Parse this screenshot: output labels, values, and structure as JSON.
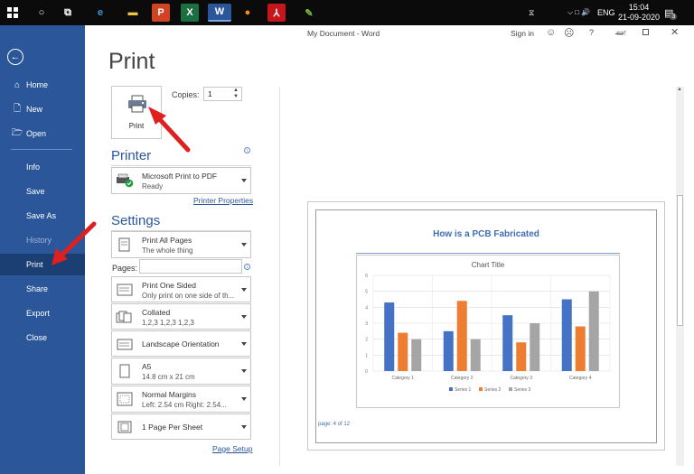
{
  "taskbar": {
    "apps": [
      {
        "name": "cortana",
        "glyph": "○",
        "color": "#ffffff",
        "bg": "#0b0b0b"
      },
      {
        "name": "task-view",
        "glyph": "⧉",
        "color": "#ffffff",
        "bg": "#0b0b0b"
      },
      {
        "name": "edge",
        "glyph": "e",
        "color": "#3a96dd",
        "bg": "#0b0b0b"
      },
      {
        "name": "file-explorer",
        "glyph": "▬",
        "color": "#f3c443",
        "bg": "#0b0b0b"
      },
      {
        "name": "powerpoint",
        "glyph": "P",
        "color": "#ffffff",
        "bg": "#d04423"
      },
      {
        "name": "excel",
        "glyph": "X",
        "color": "#ffffff",
        "bg": "#1d6f42"
      },
      {
        "name": "word",
        "glyph": "W",
        "color": "#ffffff",
        "bg": "#2b579a"
      },
      {
        "name": "firefox",
        "glyph": "●",
        "color": "#ff8a1c",
        "bg": "#0b0b0b"
      },
      {
        "name": "acrobat",
        "glyph": "⅄",
        "color": "#ffffff",
        "bg": "#c4161c"
      },
      {
        "name": "greenshot",
        "glyph": "✎",
        "color": "#7dbb3c",
        "bg": "#0b0b0b"
      }
    ],
    "lang": "ENG",
    "time": "15:04",
    "date": "21-09-2020",
    "notifications": "3"
  },
  "window": {
    "title": "My Document  -  Word",
    "signin": "Sign in",
    "help": "?"
  },
  "nav": {
    "home": "Home",
    "new": "New",
    "open": "Open",
    "info": "Info",
    "save": "Save",
    "save_as": "Save As",
    "history": "History",
    "print": "Print",
    "share": "Share",
    "export": "Export",
    "close": "Close"
  },
  "print": {
    "heading": "Print",
    "button_label": "Print",
    "copies_label": "Copies:",
    "copies_value": "1",
    "printer_heading": "Printer",
    "printer_name": "Microsoft Print to PDF",
    "printer_status": "Ready",
    "printer_properties": "Printer Properties",
    "settings_heading": "Settings",
    "pages_label": "Pages:",
    "page_setup": "Page Setup",
    "settings": [
      {
        "key": "range",
        "line1": "Print All Pages",
        "line2": "The whole thing"
      },
      {
        "key": "sides",
        "line1": "Print One Sided",
        "line2": "Only print on one side of th..."
      },
      {
        "key": "collation",
        "line1": "Collated",
        "line2": "1,2,3    1,2,3    1,2,3"
      },
      {
        "key": "orientation",
        "line1": "Landscape Orientation",
        "line2": ""
      },
      {
        "key": "paper",
        "line1": "A5",
        "line2": "14.8 cm x 21 cm"
      },
      {
        "key": "margins",
        "line1": "Normal Margins",
        "line2": "Left:  2.54 cm    Right:  2.54..."
      },
      {
        "key": "per-sheet",
        "line1": "1 Page Per Sheet",
        "line2": ""
      }
    ]
  },
  "preview": {
    "doc_heading": "How is a PCB Fabricated",
    "page_indicator": "page: 4 of 12"
  },
  "colors": {
    "accent": "#2b579a",
    "s1": "#4472c4",
    "s2": "#ed7d31",
    "s3": "#a5a5a5"
  },
  "chart_data": {
    "type": "bar",
    "title": "Chart Title",
    "categories": [
      "Category 1",
      "Category 2",
      "Category 3",
      "Category 4"
    ],
    "series": [
      {
        "name": "Series 1",
        "values": [
          4.3,
          2.5,
          3.5,
          4.5
        ]
      },
      {
        "name": "Series 2",
        "values": [
          2.4,
          4.4,
          1.8,
          2.8
        ]
      },
      {
        "name": "Series 3",
        "values": [
          2,
          2,
          3,
          5
        ]
      }
    ],
    "ylim": [
      0,
      6
    ],
    "yticks": [
      "0",
      "1",
      "2",
      "3",
      "4",
      "5",
      "6"
    ],
    "grid": true,
    "legend": "bottom"
  }
}
